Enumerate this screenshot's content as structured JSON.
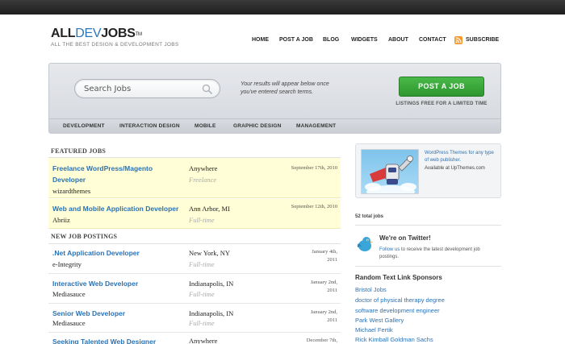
{
  "header": {
    "logo_prefix": "ALL",
    "logo_highlight": "DEV",
    "logo_suffix": "JOBS",
    "logo_tm": "TM",
    "tagline": "ALL THE BEST DESIGN & DEVELOPMENT JOBS",
    "nav": [
      "HOME",
      "POST A JOB",
      "BLOG",
      "WIDGETS",
      "ABOUT",
      "CONTACT",
      "SUBSCRIBE"
    ]
  },
  "hero": {
    "search_placeholder": "Search Jobs",
    "note": "Your results will appear below once you've entered search terms.",
    "post_button": "POST A JOB",
    "post_sub": "LISTINGS FREE FOR A LIMITED TIME",
    "categories": [
      "DEVELOPMENT",
      "INTERACTION DESIGN",
      "MOBILE",
      "GRAPHIC DESIGN",
      "MANAGEMENT"
    ]
  },
  "featured": {
    "heading": "FEATURED JOBS",
    "jobs": [
      {
        "title": "Freelance WordPress/Magento Developer",
        "company": "wizardthemes",
        "location": "Anywhere",
        "type": "Freelance",
        "date": "September 17th, 2010"
      },
      {
        "title": "Web and Mobile Application Developer",
        "company": "Abriiz",
        "location": "Ann Arbor, MI",
        "type": "Full-time",
        "date": "September 12th, 2010"
      }
    ]
  },
  "new_postings": {
    "heading": "NEW JOB POSTINGS",
    "jobs": [
      {
        "title": ".Net Application Developer",
        "company": "e-Integrity",
        "location": "New York, NY",
        "type": "Full-time",
        "date": "January 4th, 2011"
      },
      {
        "title": "Interactive Web Developer",
        "company": "Mediasauce",
        "location": "Indianapolis, IN",
        "type": "Full-time",
        "date": "January 2nd, 2011"
      },
      {
        "title": "Senior Web Developer",
        "company": "Mediasauce",
        "location": "Indianapolis, IN",
        "type": "Full-time",
        "date": "January 2nd, 2011"
      },
      {
        "title": "Seeking Talented Web Designer",
        "company": "",
        "location": "Anywhere",
        "type": "",
        "date": "December 7th,"
      }
    ]
  },
  "sidebar": {
    "ad_text": "WordPress Themes for any type of web publisher.",
    "ad_sub": "Available at UpThemes.com",
    "total_jobs": "52 total jobs",
    "twitter_title": "We're on Twitter!",
    "twitter_link": "Follow us",
    "twitter_text": " to receive the latest development job postings.",
    "sponsors_heading": "Random Text Link Sponsors",
    "sponsors": [
      "Bristol Jobs",
      "doctor of physical therapy degree",
      "software development engineer",
      "Park West Gallery",
      "Michael Fertik",
      "Rick Kimball Goldman Sachs"
    ]
  },
  "colors": {
    "link": "#2a72b5",
    "button": "#3aa63a",
    "featured_bg": "#fffed6",
    "rss": "#f29a2e"
  }
}
